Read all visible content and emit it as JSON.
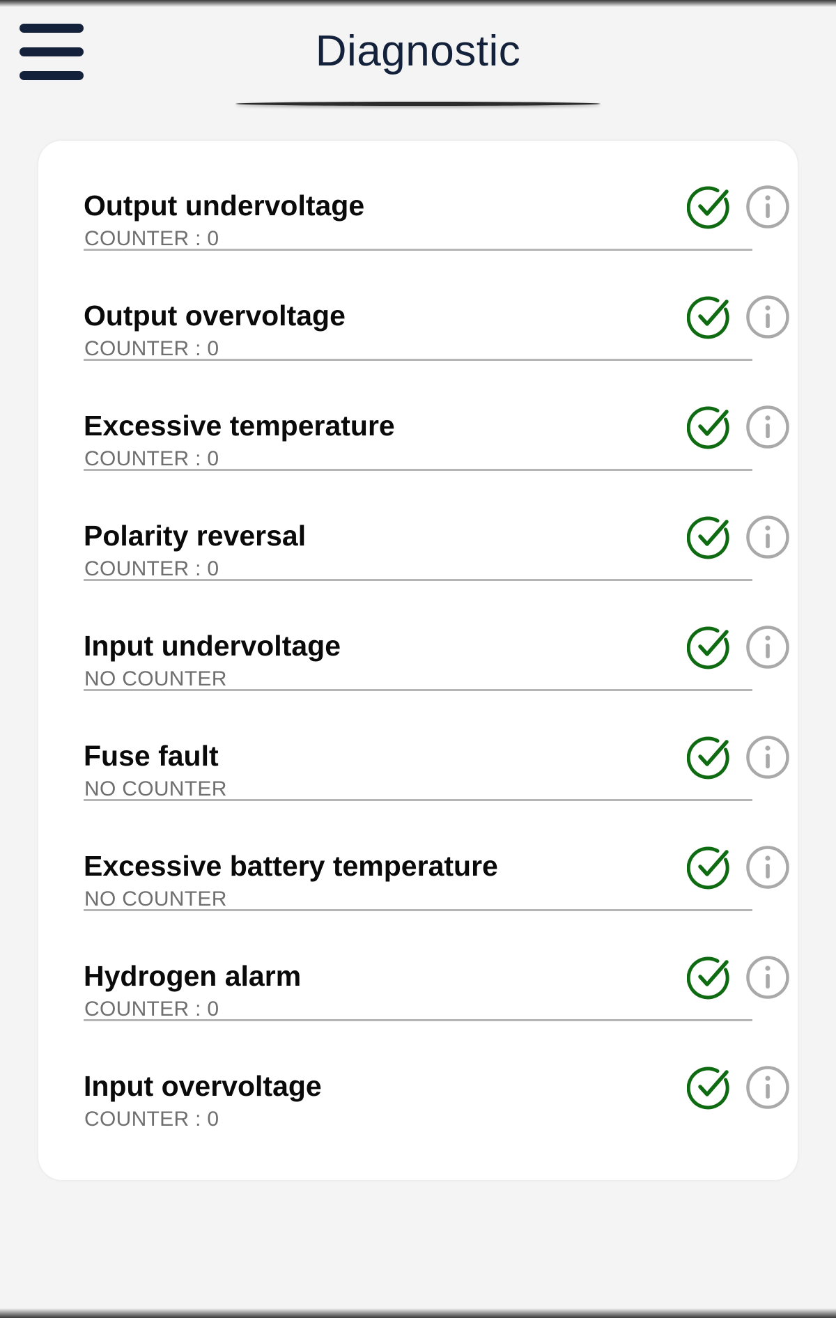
{
  "header": {
    "title": "Diagnostic"
  },
  "colors": {
    "ok": "#0f6b12",
    "info": "#a9a9a9",
    "title": "#14213a"
  },
  "diagnostics": [
    {
      "name": "Output undervoltage",
      "counter": "COUNTER : 0",
      "status_icon": "check-circle-icon",
      "info_icon": "info-icon"
    },
    {
      "name": "Output overvoltage",
      "counter": "COUNTER : 0",
      "status_icon": "check-circle-icon",
      "info_icon": "info-icon"
    },
    {
      "name": "Excessive temperature",
      "counter": "COUNTER : 0",
      "status_icon": "check-circle-icon",
      "info_icon": "info-icon"
    },
    {
      "name": "Polarity reversal",
      "counter": "COUNTER : 0",
      "status_icon": "check-circle-icon",
      "info_icon": "info-icon"
    },
    {
      "name": "Input undervoltage",
      "counter": "NO COUNTER",
      "status_icon": "check-circle-icon",
      "info_icon": "info-icon"
    },
    {
      "name": "Fuse fault",
      "counter": "NO COUNTER",
      "status_icon": "check-circle-icon",
      "info_icon": "info-icon"
    },
    {
      "name": "Excessive battery temperature",
      "counter": "NO COUNTER",
      "status_icon": "check-circle-icon",
      "info_icon": "info-icon"
    },
    {
      "name": "Hydrogen alarm",
      "counter": "COUNTER : 0",
      "status_icon": "check-circle-icon",
      "info_icon": "info-icon"
    },
    {
      "name": "Input overvoltage",
      "counter": "COUNTER : 0",
      "status_icon": "check-circle-icon",
      "info_icon": "info-icon"
    }
  ]
}
